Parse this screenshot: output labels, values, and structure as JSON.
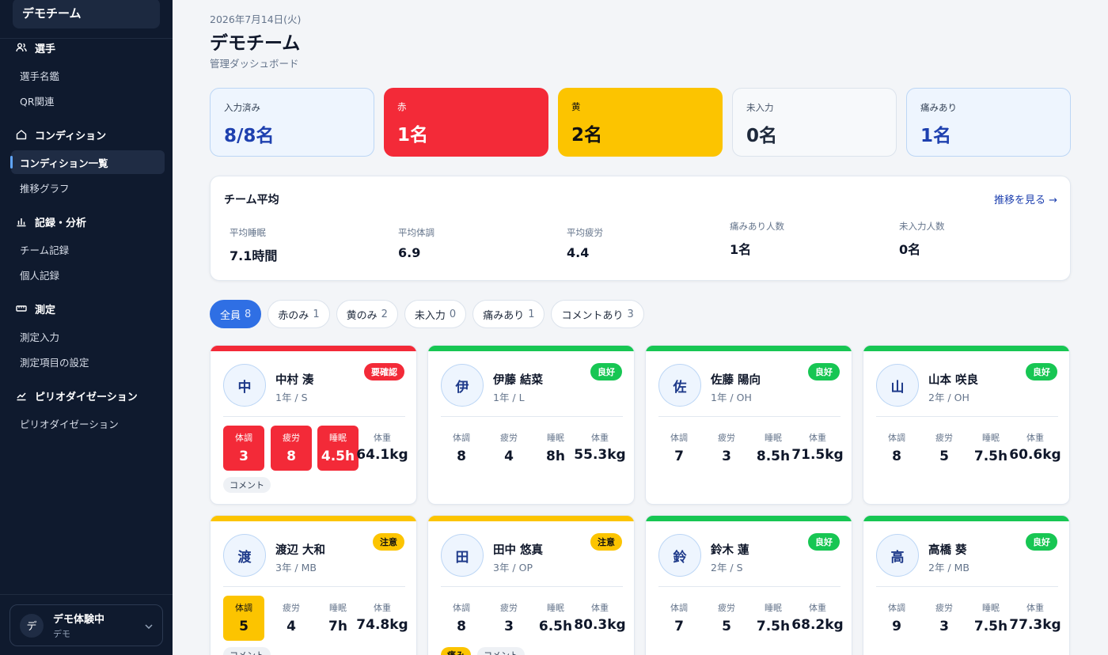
{
  "sidebar": {
    "team_name": "デモチーム",
    "sections": [
      {
        "icon": "users-icon",
        "label": "選手",
        "items": [
          {
            "label": "選手名鑑"
          },
          {
            "label": "QR関連"
          }
        ]
      },
      {
        "icon": "home-icon",
        "label": "コンディション",
        "items": [
          {
            "label": "コンディション一覧",
            "active": true
          },
          {
            "label": "推移グラフ"
          }
        ]
      },
      {
        "icon": "bar-chart-icon",
        "label": "記録・分析",
        "items": [
          {
            "label": "チーム記録"
          },
          {
            "label": "個人記録"
          }
        ]
      },
      {
        "icon": "ruler-icon",
        "label": "測定",
        "items": [
          {
            "label": "測定入力"
          },
          {
            "label": "測定項目の設定"
          }
        ]
      },
      {
        "icon": "trend-icon",
        "label": "ピリオダイゼーション",
        "items": [
          {
            "label": "ピリオダイゼーション"
          }
        ]
      }
    ],
    "user": {
      "avatar": "デ",
      "name": "デモ体験中",
      "sub": "デモ"
    }
  },
  "header": {
    "date": "2026年7月14日(火)",
    "title": "デモチーム",
    "subtitle": "管理ダッシュボード"
  },
  "stats": [
    {
      "label": "入力済み",
      "value": "8/8名",
      "style": "blue"
    },
    {
      "label": "赤",
      "value": "1名",
      "style": "red"
    },
    {
      "label": "黄",
      "value": "2名",
      "style": "yellow"
    },
    {
      "label": "未入力",
      "value": "0名",
      "style": "gray"
    },
    {
      "label": "痛みあり",
      "value": "1名",
      "style": "blue"
    }
  ],
  "averages": {
    "title": "チーム平均",
    "link": "推移を見る →",
    "items": [
      {
        "label": "平均睡眠",
        "value": "7.1時間"
      },
      {
        "label": "平均体調",
        "value": "6.9"
      },
      {
        "label": "平均疲労",
        "value": "4.4"
      },
      {
        "label": "痛みあり人数",
        "value": "1名"
      },
      {
        "label": "未入力人数",
        "value": "0名"
      }
    ]
  },
  "filters": [
    {
      "label": "全員",
      "count": "8",
      "active": true
    },
    {
      "label": "赤のみ",
      "count": "1"
    },
    {
      "label": "黄のみ",
      "count": "2"
    },
    {
      "label": "未入力",
      "count": "0"
    },
    {
      "label": "痛みあり",
      "count": "1"
    },
    {
      "label": "コメントあり",
      "count": "3"
    }
  ],
  "metric_labels": {
    "condition": "体調",
    "fatigue": "疲労",
    "sleep": "睡眠",
    "weight": "体重"
  },
  "players": [
    {
      "initial": "中",
      "name": "中村 湊",
      "meta": "1年 / S",
      "status": "要確認",
      "status_color": "red",
      "condition": "3",
      "fatigue": "8",
      "sleep": "4.5h",
      "weight": "64.1kg",
      "alerts": [
        "condition",
        "fatigue",
        "sleep"
      ],
      "alert_color": "red",
      "tags": [
        "コメント"
      ]
    },
    {
      "initial": "伊",
      "name": "伊藤 結菜",
      "meta": "1年 / L",
      "status": "良好",
      "status_color": "green",
      "condition": "8",
      "fatigue": "4",
      "sleep": "8h",
      "weight": "55.3kg",
      "alerts": [],
      "tags": []
    },
    {
      "initial": "佐",
      "name": "佐藤 陽向",
      "meta": "1年 / OH",
      "status": "良好",
      "status_color": "green",
      "condition": "7",
      "fatigue": "3",
      "sleep": "8.5h",
      "weight": "71.5kg",
      "alerts": [],
      "tags": []
    },
    {
      "initial": "山",
      "name": "山本 咲良",
      "meta": "2年 / OH",
      "status": "良好",
      "status_color": "green",
      "condition": "8",
      "fatigue": "5",
      "sleep": "7.5h",
      "weight": "60.6kg",
      "alerts": [],
      "tags": []
    },
    {
      "initial": "渡",
      "name": "渡辺 大和",
      "meta": "3年 / MB",
      "status": "注意",
      "status_color": "yellow",
      "condition": "5",
      "fatigue": "4",
      "sleep": "7h",
      "weight": "74.8kg",
      "alerts": [
        "condition"
      ],
      "alert_color": "yellow",
      "tags": [
        "コメント"
      ]
    },
    {
      "initial": "田",
      "name": "田中 悠真",
      "meta": "3年 / OP",
      "status": "注意",
      "status_color": "yellow",
      "condition": "8",
      "fatigue": "3",
      "sleep": "6.5h",
      "weight": "80.3kg",
      "alerts": [],
      "tags": [
        "痛み",
        "コメント"
      ]
    },
    {
      "initial": "鈴",
      "name": "鈴木 蓮",
      "meta": "2年 / S",
      "status": "良好",
      "status_color": "green",
      "condition": "7",
      "fatigue": "5",
      "sleep": "7.5h",
      "weight": "68.2kg",
      "alerts": [],
      "tags": []
    },
    {
      "initial": "高",
      "name": "高橋 葵",
      "meta": "2年 / MB",
      "status": "良好",
      "status_color": "green",
      "condition": "9",
      "fatigue": "3",
      "sleep": "7.5h",
      "weight": "77.3kg",
      "alerts": [],
      "tags": []
    }
  ],
  "colors": {
    "red": "#f32a38",
    "green": "#17c653",
    "yellow": "#fcc400",
    "accent": "#2f6fe4"
  }
}
